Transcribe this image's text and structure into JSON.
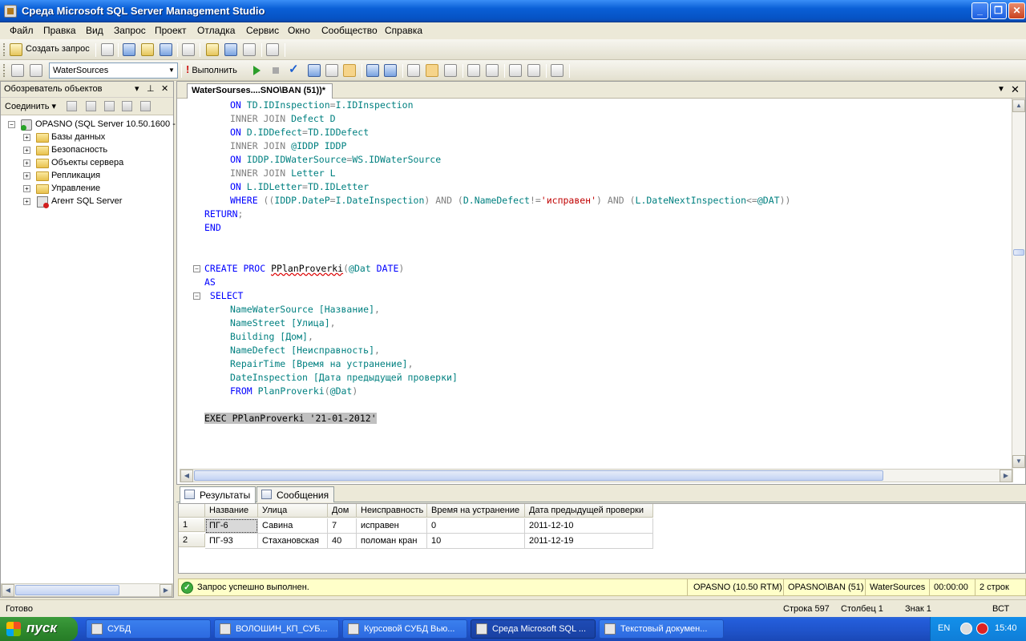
{
  "window": {
    "title": "Среда Microsoft SQL Server Management Studio"
  },
  "menu": [
    "Файл",
    "Правка",
    "Вид",
    "Запрос",
    "Проект",
    "Отладка",
    "Сервис",
    "Окно",
    "Сообщество",
    "Справка"
  ],
  "toolbar": {
    "new_query_label": "Создать запрос",
    "database": "WaterSources",
    "execute_label": "Выполнить"
  },
  "object_explorer": {
    "title": "Обозреватель объектов",
    "connect_label": "Соединить",
    "server": "OPASNO (SQL Server 10.50.1600 -",
    "children": [
      "Базы данных",
      "Безопасность",
      "Объекты сервера",
      "Репликация",
      "Управление",
      "Агент SQL Server"
    ]
  },
  "editor": {
    "tab_title": "WaterSourses....SNO\\BAN (51))*",
    "lines": [
      {
        "indent": 2,
        "tokens": [
          [
            "kw",
            "ON "
          ],
          [
            "id",
            "TD.IDInspection"
          ],
          [
            "kwg",
            "="
          ],
          [
            "id",
            "I.IDInspection"
          ]
        ]
      },
      {
        "indent": 2,
        "tokens": [
          [
            "kwg",
            "INNER JOIN "
          ],
          [
            "id",
            "Defect D"
          ]
        ]
      },
      {
        "indent": 2,
        "tokens": [
          [
            "kw",
            "ON "
          ],
          [
            "id",
            "D.IDDefect"
          ],
          [
            "kwg",
            "="
          ],
          [
            "id",
            "TD.IDDefect"
          ]
        ]
      },
      {
        "indent": 2,
        "tokens": [
          [
            "kwg",
            "INNER JOIN "
          ],
          [
            "id",
            "@IDDP IDDP"
          ]
        ]
      },
      {
        "indent": 2,
        "tokens": [
          [
            "kw",
            "ON "
          ],
          [
            "id",
            "IDDP.IDWaterSource"
          ],
          [
            "kwg",
            "="
          ],
          [
            "id",
            "WS.IDWaterSource"
          ]
        ]
      },
      {
        "indent": 2,
        "tokens": [
          [
            "kwg",
            "INNER JOIN "
          ],
          [
            "id",
            "Letter L"
          ]
        ]
      },
      {
        "indent": 2,
        "tokens": [
          [
            "kw",
            "ON "
          ],
          [
            "id",
            "L.IDLetter"
          ],
          [
            "kwg",
            "="
          ],
          [
            "id",
            "TD.IDLetter"
          ]
        ]
      },
      {
        "indent": 2,
        "tokens": [
          [
            "kw",
            "WHERE "
          ],
          [
            "kwg",
            "(("
          ],
          [
            "id",
            "IDDP.DateP"
          ],
          [
            "kwg",
            "="
          ],
          [
            "id",
            "I.DateInspection"
          ],
          [
            "kwg",
            ") AND ("
          ],
          [
            "id",
            "D.NameDefect"
          ],
          [
            "kwg",
            "!="
          ],
          [
            "str",
            "'исправен'"
          ],
          [
            "kwg",
            ") AND ("
          ],
          [
            "id",
            "L.DateNextInspection"
          ],
          [
            "kwg",
            "<="
          ],
          [
            "id",
            "@DAT"
          ],
          [
            "kwg",
            "))"
          ]
        ]
      },
      {
        "indent": 0,
        "tokens": [
          [
            "kw",
            "RETURN"
          ],
          [
            "kwg",
            ";"
          ]
        ]
      },
      {
        "indent": 0,
        "tokens": [
          [
            "kw",
            "END"
          ]
        ]
      },
      {
        "indent": 0,
        "tokens": []
      },
      {
        "indent": 0,
        "tokens": []
      },
      {
        "indent": 0,
        "fold": true,
        "tokens": [
          [
            "kw",
            "CREATE PROC "
          ],
          [
            "sq",
            "PPlanProverki"
          ],
          [
            "kwg",
            "("
          ],
          [
            "id",
            "@Dat "
          ],
          [
            "kw",
            "DATE"
          ],
          [
            "kwg",
            ")"
          ]
        ]
      },
      {
        "indent": 0,
        "tokens": [
          [
            "kw",
            "AS"
          ]
        ]
      },
      {
        "indent": 0,
        "fold": true,
        "tokens": [
          [
            "kw",
            " SELECT"
          ]
        ]
      },
      {
        "indent": 2,
        "tokens": [
          [
            "id",
            "NameWaterSource [Название]"
          ],
          [
            "kwg",
            ","
          ]
        ]
      },
      {
        "indent": 2,
        "tokens": [
          [
            "id",
            "NameStreet [Улица]"
          ],
          [
            "kwg",
            ","
          ]
        ]
      },
      {
        "indent": 2,
        "tokens": [
          [
            "id",
            "Building [Дом]"
          ],
          [
            "kwg",
            ","
          ]
        ]
      },
      {
        "indent": 2,
        "tokens": [
          [
            "id",
            "NameDefect [Неисправность]"
          ],
          [
            "kwg",
            ","
          ]
        ]
      },
      {
        "indent": 2,
        "tokens": [
          [
            "id",
            "RepairTime [Время на устранение]"
          ],
          [
            "kwg",
            ","
          ]
        ]
      },
      {
        "indent": 2,
        "tokens": [
          [
            "id",
            "DateInspection [Дата предыдущей проверки]"
          ]
        ]
      },
      {
        "indent": 2,
        "tokens": [
          [
            "kw",
            "FROM "
          ],
          [
            "id",
            "PlanProverki"
          ],
          [
            "kwg",
            "("
          ],
          [
            "id",
            "@Dat"
          ],
          [
            "kwg",
            ")"
          ]
        ]
      },
      {
        "indent": 0,
        "tokens": []
      },
      {
        "indent": 0,
        "selected": true,
        "tokens": [
          [
            "pl",
            "EXEC PPlanProverki '21-01-2012'"
          ]
        ]
      }
    ]
  },
  "results": {
    "tab_results": "Результаты",
    "tab_messages": "Сообщения",
    "columns": [
      "Название",
      "Улица",
      "Дом",
      "Неисправность",
      "Время на устранение",
      "Дата предыдущей проверки"
    ],
    "rows": [
      [
        "1",
        "ПГ-6",
        "Савина",
        "7",
        "исправен",
        "0",
        "2011-12-10"
      ],
      [
        "2",
        "ПГ-93",
        "Стахановская",
        "40",
        "поломан кран",
        "10",
        "2011-12-19"
      ]
    ],
    "status_message": "Запрос успешно выполнен.",
    "server": "OPASNO (10.50 RTM)",
    "user": "OPASNO\\BAN (51)",
    "database": "WaterSources",
    "elapsed": "00:00:00",
    "row_count": "2 строк"
  },
  "statusbar": {
    "ready": "Готово",
    "line": "Строка 597",
    "column": "Столбец 1",
    "char": "Знак 1",
    "mode": "ВСТ"
  },
  "taskbar": {
    "start": "пуск",
    "tasks": [
      "СУБД",
      "ВОЛОШИН_КП_СУБ...",
      "Курсовой СУБД Вью...",
      "Среда Microsoft SQL ...",
      "Текстовый докумен..."
    ],
    "lang": "EN",
    "clock": "15:40"
  }
}
